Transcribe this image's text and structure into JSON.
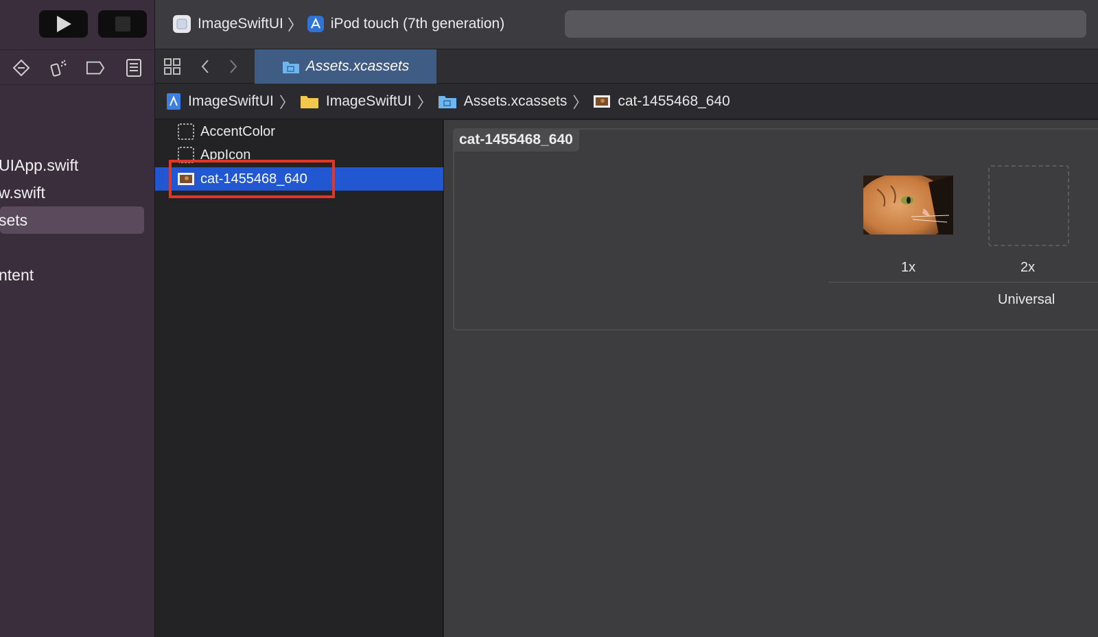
{
  "sidebar": {
    "files": [
      {
        "label": "UIApp.swift",
        "selected": false
      },
      {
        "label": "w.swift",
        "selected": false
      },
      {
        "label": "sets",
        "selected": true
      },
      {
        "label": "ntent",
        "selected": false
      }
    ]
  },
  "titlebar": {
    "scheme": "ImageSwiftUI",
    "device": "iPod touch (7th generation)"
  },
  "tab": {
    "label": "Assets.xcassets"
  },
  "jumpbar": {
    "crumbs": [
      "ImageSwiftUI",
      "ImageSwiftUI",
      "Assets.xcassets",
      "cat-1455468_640"
    ]
  },
  "assets": {
    "items": [
      {
        "label": "AccentColor",
        "selected": false
      },
      {
        "label": "AppIcon",
        "selected": false
      },
      {
        "label": "cat-1455468_640",
        "selected": true
      }
    ]
  },
  "detail": {
    "title": "cat-1455468_640",
    "slot_1x": "1x",
    "slot_2x": "2x",
    "group_label": "Universal"
  },
  "colors": {
    "selection": "#2157d1",
    "highlight_box": "#e53524",
    "sidebar_bg": "#3a2e3c"
  }
}
